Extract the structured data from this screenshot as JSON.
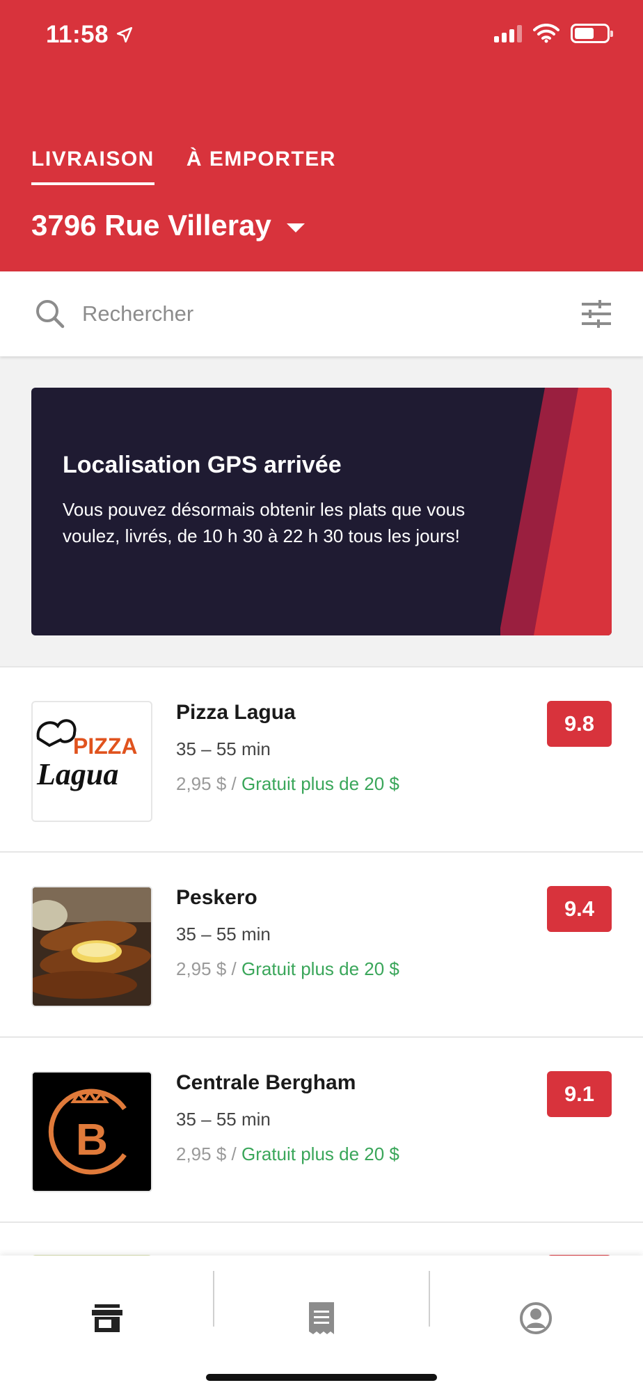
{
  "status_bar": {
    "time": "11:58"
  },
  "header": {
    "tabs": [
      {
        "label": "LIVRAISON",
        "active": true
      },
      {
        "label": "À EMPORTER",
        "active": false
      }
    ],
    "address": "3796 Rue Villeray"
  },
  "search": {
    "placeholder": "Rechercher"
  },
  "banner": {
    "title": "Localisation GPS arrivée",
    "body": "Vous pouvez désormais obtenir les plats que vous voulez, livrés, de 10 h 30 à 22 h 30 tous les jours!"
  },
  "restaurants": [
    {
      "name": "Pizza Lagua",
      "time": "35 – 55 min",
      "fee": "2,95 $ / ",
      "free_label": "Gratuit plus de 20 $",
      "rating": "9.8",
      "logo": "pizza-lagua-logo",
      "logo_text_top": "PIZZA",
      "logo_text_bottom": "Lagua"
    },
    {
      "name": "Peskero",
      "time": "35 – 55 min",
      "fee": "2,95 $ / ",
      "free_label": "Gratuit plus de 20 $",
      "rating": "9.4",
      "logo": "fried-fish-photo"
    },
    {
      "name": "Centrale Bergham",
      "time": "35 – 55 min",
      "fee": "2,95 $ / ",
      "free_label": "Gratuit plus de 20 $",
      "rating": "9.1",
      "logo": "centrale-bergham-logo"
    }
  ],
  "bottom_nav": [
    {
      "icon": "store-icon",
      "active": true
    },
    {
      "icon": "receipt-icon",
      "active": false
    },
    {
      "icon": "account-icon",
      "active": false
    }
  ],
  "colors": {
    "brand": "#d8333c",
    "banner": "#1f1b32",
    "free": "#3aa65a"
  }
}
